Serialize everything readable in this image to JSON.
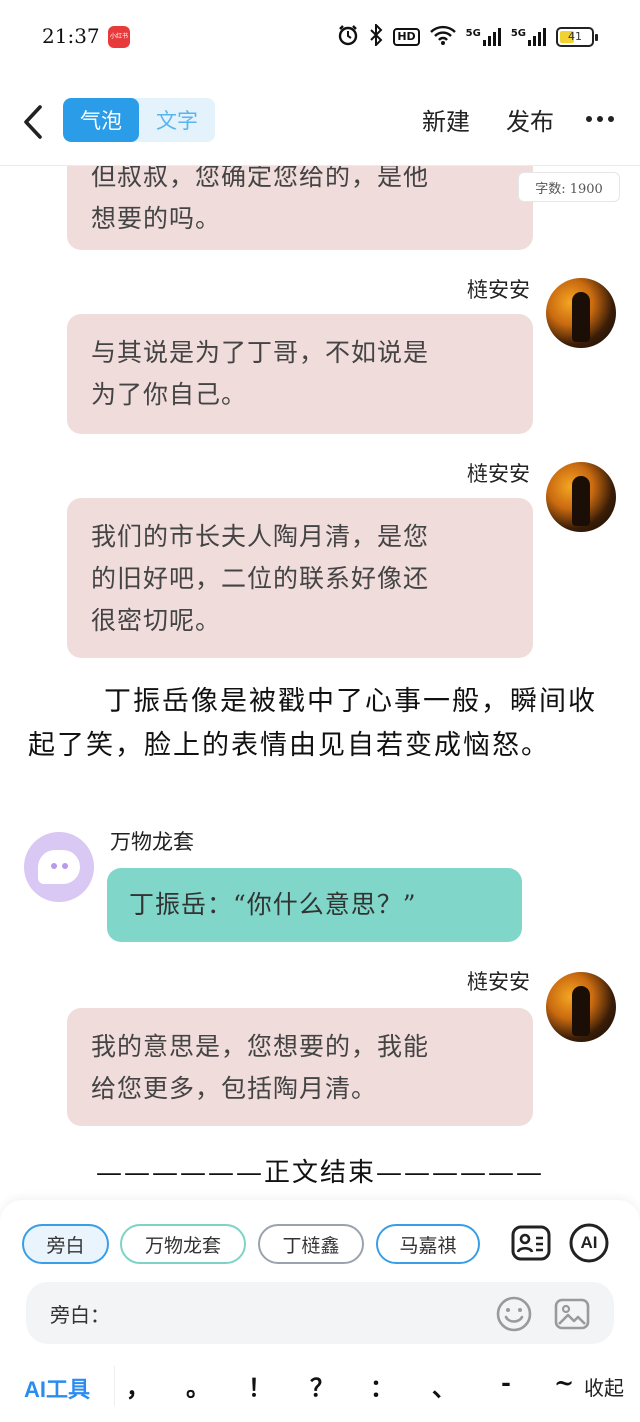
{
  "status_bar": {
    "time": "21:37",
    "app_badge": "小红书",
    "hd_label": "HD",
    "network_1": "5G",
    "network_2": "5G",
    "battery_level": "41"
  },
  "nav": {
    "tabs": [
      "气泡",
      "文字"
    ],
    "active_tab": "气泡",
    "new_label": "新建",
    "publish_label": "发布"
  },
  "word_count": "字数: 1900",
  "messages": [
    {
      "type": "bubble-right",
      "sender": "",
      "text": "但叔叔，您确定您给的，是他想要的吗。"
    },
    {
      "type": "bubble-right",
      "sender": "梿安安",
      "text": "与其说是为了丁哥，不如说是为了你自己。"
    },
    {
      "type": "bubble-right",
      "sender": "梿安安",
      "text": "我们的市长夫人陶月清，是您的旧好吧，二位的联系好像还很密切呢。"
    },
    {
      "type": "narration",
      "text": "丁振岳像是被戳中了心事一般，瞬间收起了笑，脸上的表情由见自若变成恼怒。"
    },
    {
      "type": "bubble-left",
      "sender": "万物龙套",
      "text": "丁振岳：“你什么意思？”"
    },
    {
      "type": "bubble-right",
      "sender": "梿安安",
      "text": "我的意思是，您想要的，我能给您更多，包括陶月清。"
    },
    {
      "type": "end",
      "text": "——————正文结束——————"
    }
  ],
  "bubble_top_partial": {
    "line1": "但叔叔，您确定您给的，是他",
    "line2": "想要的吗。"
  },
  "bubble2": {
    "line1": "与其说是为了丁哥，不如说是",
    "line2": "为了你自己。"
  },
  "bubble3": {
    "line1": "我们的市长夫人陶月清，是您",
    "line2": "的旧好吧，二位的联系好像还",
    "line3": "很密切呢。"
  },
  "narration": {
    "text": "丁振岳像是被戳中了心事一般，瞬间收起了笑，脸上的表情由见自若变成恼怒。"
  },
  "bot_bubble": {
    "name": "万物龙套",
    "text": "丁振岳：“你什么意思？”"
  },
  "bubble5": {
    "line1": "我的意思是，您想要的，我能",
    "line2": "给您更多，包括陶月清。"
  },
  "sender_name": "梿安安",
  "end_text": "——————正文结束——————",
  "editor": {
    "chips": [
      "旁白",
      "万物龙套",
      "丁梿鑫",
      "马嘉祺"
    ],
    "selected_chip": "旁白",
    "ai_button_label": "AI",
    "input_label": "旁白：",
    "ai_tools_label": "AI工具",
    "punctuation": [
      "，",
      "。",
      "！",
      "？",
      "：",
      "、",
      "-",
      "~"
    ],
    "collapse_label": "收起"
  },
  "colors": {
    "accent": "#2b9ce8",
    "pink_bubble": "#f1dcdc",
    "teal_bubble": "#7fd6c9",
    "bot_avatar": "#d9c7f4"
  }
}
